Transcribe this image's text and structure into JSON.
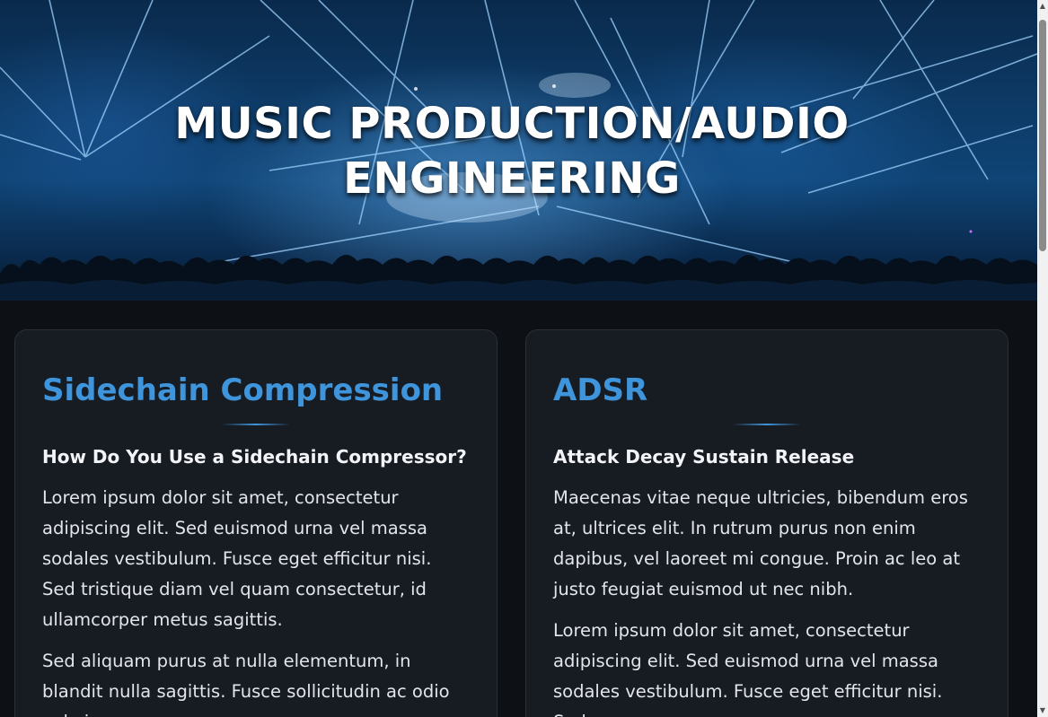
{
  "hero": {
    "title": "MUSIC PRODUCTION/AUDIO ENGINEERING"
  },
  "cards": [
    {
      "title": "Sidechain Compression",
      "subtitle": "How Do You Use a Sidechain Compressor?",
      "paragraphs": [
        "Lorem ipsum dolor sit amet, consectetur adipiscing elit. Sed euismod urna vel massa sodales vestibulum. Fusce eget efficitur nisi. Sed tristique diam vel quam consectetur, id ullamcorper metus sagittis.",
        "Sed aliquam purus at nulla elementum, in blandit nulla sagittis. Fusce sollicitudin ac odio vel viverra."
      ]
    },
    {
      "title": "ADSR",
      "subtitle": "Attack Decay Sustain Release",
      "paragraphs": [
        "Maecenas vitae neque ultricies, bibendum eros at, ultrices elit. In rutrum purus non enim dapibus, vel laoreet mi congue. Proin ac leo at justo feugiat euismod ut nec nibh.",
        "Lorem ipsum dolor sit amet, consectetur adipiscing elit. Sed euismod urna vel massa sodales vestibulum. Fusce eget efficitur nisi. Sed"
      ]
    }
  ],
  "colors": {
    "accent": "#3f95dc",
    "page_background": "#0d1015",
    "card_background": "#171b22"
  },
  "icons": {
    "scroll_up": "arrow-up-icon",
    "scroll_down": "arrow-down-icon"
  }
}
